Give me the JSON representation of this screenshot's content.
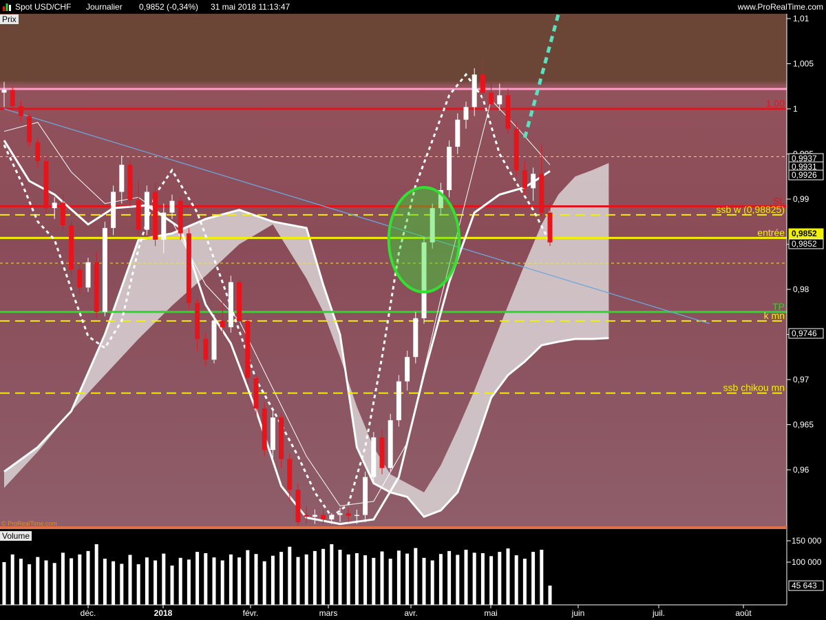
{
  "header": {
    "instrument": "Spot USD/CHF",
    "period": "Journalier",
    "last_quote": "0,9852 (-0,34%)",
    "datetime": "31 mai 2018 11:13:47",
    "website": "www.ProRealTime.com"
  },
  "price_panel": {
    "title": "Prix",
    "watermark": "© ProRealTime.com",
    "axis_ticks": [
      "1,01",
      "1,005",
      "1",
      "0,995",
      "0,99",
      "0,985",
      "0,98",
      "0,975",
      "0,97",
      "0,965",
      "0,96"
    ],
    "price_tags": [
      {
        "text": "0,9937",
        "style": "white"
      },
      {
        "text": "0,9931",
        "style": "white"
      },
      {
        "text": "0,9926",
        "style": "white"
      },
      {
        "text": "0,9852",
        "style": "yellow"
      },
      {
        "text": "0,9852",
        "style": "white"
      },
      {
        "text": "0,9746",
        "style": "white"
      }
    ]
  },
  "volume_panel": {
    "title": "Volume",
    "axis_ticks": [
      "150 000",
      "100 000"
    ],
    "last_value": "45 643"
  },
  "x_axis_labels": [
    "déc.",
    "2018",
    "févr.",
    "mars",
    "avr.",
    "mai",
    "juin",
    "juil.",
    "août"
  ],
  "colors": {
    "background_upper": "#6b4535",
    "background_lower": "#8a5560",
    "up_candle": "#ffffff",
    "down_candle": "#e8141c",
    "kumo": "#d9d4d6",
    "sl_line": "#e0141c",
    "entry_line": "#f0f000",
    "tp_line": "#2ad82a",
    "fibo_line": "#ff9ec4",
    "trendline": "#6aa6dc",
    "projection": "#5de0c0",
    "highlight_ellipse": "#32e032"
  },
  "chart_data": {
    "type": "candlestick",
    "instrument": "USD/CHF",
    "timeframe": "daily",
    "ylim": [
      0.954,
      1.0115
    ],
    "xlim": [
      "2018-11-01",
      "2018-08-28"
    ],
    "price_lines": [
      {
        "label": "1.00",
        "value": 1.0,
        "color": "#e0141c",
        "style": "solid"
      },
      {
        "label": "SL",
        "value": 0.9892,
        "color": "#e0141c",
        "style": "solid"
      },
      {
        "label": "ssb w (0,98825)",
        "value": 0.98825,
        "color": "#f0f000",
        "style": "dashed"
      },
      {
        "label": "entrée",
        "value": 0.9857,
        "color": "#f0f000",
        "style": "solid"
      },
      {
        "label": "TP",
        "value": 0.9775,
        "color": "#2ad82a",
        "style": "solid"
      },
      {
        "label": "k mn",
        "value": 0.9765,
        "color": "#f0f000",
        "style": "dashed"
      },
      {
        "label": "ssb chikou mn",
        "value": 0.9685,
        "color": "#f0f000",
        "style": "dashed"
      },
      {
        "label": "",
        "value": 1.0022,
        "color": "#ff9ec4",
        "style": "solid"
      },
      {
        "label": "",
        "value": 0.9947,
        "color": "#f0f000",
        "style": "dotted"
      },
      {
        "label": "",
        "value": 0.9829,
        "color": "#f0f000",
        "style": "dotted"
      }
    ],
    "trendline": {
      "from": [
        0,
        1.0
      ],
      "to": [
        84,
        0.9762
      ]
    },
    "projection": {
      "from": [
        62,
        0.9968
      ],
      "to": [
        66,
        1.0105
      ]
    },
    "highlight_ellipse": {
      "center": [
        50,
        0.9855
      ],
      "radius_x": 4.2,
      "radius_y": 0.0058
    },
    "candles": [
      [
        1.0018,
        1.003,
        1.0002,
        1.0021
      ],
      [
        1.0021,
        1.0025,
        0.9998,
        1.0003
      ],
      [
        1.0003,
        1.0009,
        0.9986,
        0.9992
      ],
      [
        0.9992,
        0.9995,
        0.9958,
        0.9963
      ],
      [
        0.9963,
        0.9968,
        0.9935,
        0.9942
      ],
      [
        0.9942,
        0.9948,
        0.9884,
        0.989
      ],
      [
        0.989,
        0.9902,
        0.9878,
        0.9896
      ],
      [
        0.9896,
        0.9905,
        0.9865,
        0.9871
      ],
      [
        0.9871,
        0.9876,
        0.9815,
        0.9822
      ],
      [
        0.9822,
        0.9828,
        0.9795,
        0.9802
      ],
      [
        0.9802,
        0.9835,
        0.9797,
        0.983
      ],
      [
        0.983,
        0.9842,
        0.9768,
        0.9775
      ],
      [
        0.9775,
        0.9875,
        0.977,
        0.9868
      ],
      [
        0.9868,
        0.9915,
        0.986,
        0.9908
      ],
      [
        0.9908,
        0.9948,
        0.9895,
        0.9938
      ],
      [
        0.9938,
        0.9942,
        0.9892,
        0.9899
      ],
      [
        0.9899,
        0.992,
        0.986,
        0.9866
      ],
      [
        0.9866,
        0.9915,
        0.986,
        0.9908
      ],
      [
        0.9908,
        0.9918,
        0.9848,
        0.9855
      ],
      [
        0.9855,
        0.9895,
        0.984,
        0.9885
      ],
      [
        0.9885,
        0.9905,
        0.9878,
        0.9898
      ],
      [
        0.9898,
        0.9902,
        0.9855,
        0.9862
      ],
      [
        0.9862,
        0.9868,
        0.9778,
        0.9785
      ],
      [
        0.9785,
        0.979,
        0.9732,
        0.9745
      ],
      [
        0.9745,
        0.9752,
        0.9715,
        0.9722
      ],
      [
        0.9722,
        0.9772,
        0.9718,
        0.9765
      ],
      [
        0.9765,
        0.9788,
        0.975,
        0.9758
      ],
      [
        0.9758,
        0.9815,
        0.9752,
        0.9808
      ],
      [
        0.9808,
        0.981,
        0.976,
        0.9765
      ],
      [
        0.9765,
        0.9768,
        0.9695,
        0.9702
      ],
      [
        0.9702,
        0.9705,
        0.966,
        0.9668
      ],
      [
        0.9668,
        0.9675,
        0.9615,
        0.9622
      ],
      [
        0.9622,
        0.9665,
        0.9612,
        0.9658
      ],
      [
        0.9658,
        0.9662,
        0.9602,
        0.9612
      ],
      [
        0.9612,
        0.9618,
        0.9565,
        0.9578
      ],
      [
        0.9578,
        0.9585,
        0.9538,
        0.9542
      ],
      [
        0.955,
        0.956,
        0.954,
        0.9548
      ],
      [
        0.9548,
        0.9556,
        0.954,
        0.955
      ],
      [
        0.955,
        0.9556,
        0.954,
        0.9545
      ],
      [
        0.9545,
        0.9552,
        0.954,
        0.955
      ],
      [
        0.955,
        0.9558,
        0.9542,
        0.9552
      ],
      [
        0.9552,
        0.9558,
        0.9542,
        0.9549
      ],
      [
        0.9549,
        0.9556,
        0.954,
        0.955
      ],
      [
        0.955,
        0.9598,
        0.9542,
        0.9592
      ],
      [
        0.9592,
        0.9642,
        0.9585,
        0.9636
      ],
      [
        0.9636,
        0.9645,
        0.9595,
        0.9602
      ],
      [
        0.9602,
        0.9662,
        0.9598,
        0.9655
      ],
      [
        0.9655,
        0.9705,
        0.9648,
        0.9698
      ],
      [
        0.9698,
        0.9732,
        0.9688,
        0.9725
      ],
      [
        0.9725,
        0.9775,
        0.9718,
        0.9768
      ],
      [
        0.9768,
        0.9858,
        0.9762,
        0.9852
      ],
      [
        0.9852,
        0.9895,
        0.9845,
        0.989
      ],
      [
        0.989,
        0.9918,
        0.9882,
        0.991
      ],
      [
        0.991,
        0.9965,
        0.9902,
        0.9958
      ],
      [
        0.9958,
        0.9995,
        0.995,
        0.9988
      ],
      [
        0.9988,
        1.0008,
        0.9978,
        1.0002
      ],
      [
        1.0002,
        1.0045,
        0.9992,
        1.0038
      ],
      [
        1.0038,
        1.0056,
        1.0012,
        1.0018
      ],
      [
        1.0018,
        1.0032,
        1.0,
        1.0005
      ],
      [
        1.0005,
        1.0028,
        0.9998,
        1.0015
      ],
      [
        1.0015,
        1.0022,
        0.9972,
        0.9978
      ],
      [
        0.9978,
        0.9985,
        0.9925,
        0.9932
      ],
      [
        0.9932,
        0.9942,
        0.9905,
        0.9912
      ],
      [
        0.9912,
        0.9935,
        0.9898,
        0.9928
      ],
      [
        0.9928,
        0.996,
        0.988,
        0.9885
      ],
      [
        0.9885,
        0.9896,
        0.9848,
        0.9852
      ]
    ],
    "tenkan": [
      [
        0,
        0.9975
      ],
      [
        4,
        0.9985
      ],
      [
        8,
        0.993
      ],
      [
        12,
        0.9895
      ],
      [
        16,
        0.9902
      ],
      [
        20,
        0.9875
      ],
      [
        24,
        0.9805
      ],
      [
        28,
        0.9765
      ],
      [
        32,
        0.969
      ],
      [
        36,
        0.9615
      ],
      [
        40,
        0.956
      ],
      [
        44,
        0.9565
      ],
      [
        48,
        0.963
      ],
      [
        52,
        0.979
      ],
      [
        55,
        0.99
      ],
      [
        58,
        1.001
      ],
      [
        61,
        0.998
      ],
      [
        65,
        0.9938
      ]
    ],
    "kijun": [
      [
        0,
        0.9965
      ],
      [
        3,
        0.992
      ],
      [
        6,
        0.9905
      ],
      [
        10,
        0.9872
      ],
      [
        13,
        0.989
      ],
      [
        17,
        0.9893
      ],
      [
        21,
        0.9868
      ],
      [
        24,
        0.9783
      ],
      [
        27,
        0.974
      ],
      [
        30,
        0.9666
      ],
      [
        33,
        0.9582
      ],
      [
        36,
        0.9547
      ],
      [
        40,
        0.954
      ],
      [
        44,
        0.9545
      ],
      [
        47,
        0.9592
      ],
      [
        50,
        0.9706
      ],
      [
        53,
        0.9808
      ],
      [
        56,
        0.9885
      ],
      [
        59,
        0.9905
      ],
      [
        62,
        0.9913
      ],
      [
        65,
        0.9931
      ]
    ],
    "chikou": [
      [
        0,
        0.996
      ],
      [
        2,
        0.992
      ],
      [
        4,
        0.9875
      ],
      [
        6,
        0.9855
      ],
      [
        8,
        0.98
      ],
      [
        10,
        0.9748
      ],
      [
        12,
        0.9735
      ],
      [
        14,
        0.9765
      ],
      [
        16,
        0.9845
      ],
      [
        18,
        0.9905
      ],
      [
        20,
        0.9932
      ],
      [
        23,
        0.9885
      ],
      [
        26,
        0.9808
      ],
      [
        30,
        0.97
      ],
      [
        33,
        0.965
      ],
      [
        35,
        0.9615
      ],
      [
        37,
        0.9575
      ],
      [
        39,
        0.9548
      ],
      [
        41,
        0.9562
      ],
      [
        43,
        0.9625
      ],
      [
        45,
        0.9725
      ],
      [
        47,
        0.984
      ],
      [
        49,
        0.9915
      ],
      [
        51,
        0.9965
      ],
      [
        53,
        1.0015
      ],
      [
        55,
        1.0038
      ],
      [
        57,
        1.0012
      ],
      [
        59,
        0.995
      ],
      [
        61,
        0.9918
      ],
      [
        63,
        0.9888
      ],
      [
        65,
        0.9852
      ]
    ],
    "ssa": [
      [
        0,
        0.958
      ],
      [
        4,
        0.962
      ],
      [
        8,
        0.9665
      ],
      [
        12,
        0.9705
      ],
      [
        16,
        0.9745
      ],
      [
        20,
        0.9782
      ],
      [
        24,
        0.9815
      ],
      [
        28,
        0.985
      ],
      [
        32,
        0.9872
      ],
      [
        36,
        0.9812
      ],
      [
        38,
        0.9775
      ],
      [
        40,
        0.9725
      ],
      [
        42,
        0.967
      ],
      [
        44,
        0.9625
      ],
      [
        46,
        0.9595
      ],
      [
        48,
        0.9585
      ],
      [
        50,
        0.9575
      ],
      [
        52,
        0.9605
      ],
      [
        54,
        0.9645
      ],
      [
        56,
        0.9688
      ],
      [
        58,
        0.9735
      ],
      [
        60,
        0.9782
      ],
      [
        62,
        0.9828
      ],
      [
        64,
        0.9872
      ],
      [
        66,
        0.9905
      ],
      [
        68,
        0.9925
      ],
      [
        70,
        0.9932
      ],
      [
        72,
        0.994
      ]
    ],
    "ssb": [
      [
        0,
        0.9598
      ],
      [
        4,
        0.9625
      ],
      [
        8,
        0.9665
      ],
      [
        12,
        0.975
      ],
      [
        16,
        0.9855
      ],
      [
        20,
        0.9862
      ],
      [
        24,
        0.9878
      ],
      [
        28,
        0.9888
      ],
      [
        32,
        0.9875
      ],
      [
        36,
        0.9868
      ],
      [
        38,
        0.9805
      ],
      [
        40,
        0.975
      ],
      [
        42,
        0.9625
      ],
      [
        44,
        0.9585
      ],
      [
        46,
        0.9575
      ],
      [
        48,
        0.957
      ],
      [
        50,
        0.9548
      ],
      [
        52,
        0.9555
      ],
      [
        54,
        0.9575
      ],
      [
        56,
        0.9625
      ],
      [
        58,
        0.968
      ],
      [
        60,
        0.9705
      ],
      [
        62,
        0.972
      ],
      [
        64,
        0.9738
      ],
      [
        66,
        0.9742
      ],
      [
        68,
        0.9745
      ],
      [
        70,
        0.9745
      ],
      [
        72,
        0.9746
      ]
    ],
    "volume": [
      100,
      118,
      108,
      95,
      112,
      104,
      98,
      122,
      109,
      118,
      126,
      142,
      108,
      102,
      96,
      117,
      95,
      111,
      104,
      120,
      92,
      110,
      106,
      124,
      121,
      111,
      104,
      118,
      111,
      128,
      119,
      102,
      115,
      124,
      136,
      112,
      118,
      126,
      131,
      142,
      129,
      118,
      121,
      116,
      110,
      125,
      108,
      127,
      120,
      133,
      110,
      104,
      119,
      126,
      117,
      129,
      122,
      121,
      114,
      124,
      132,
      116,
      108,
      124,
      129,
      45
    ]
  }
}
